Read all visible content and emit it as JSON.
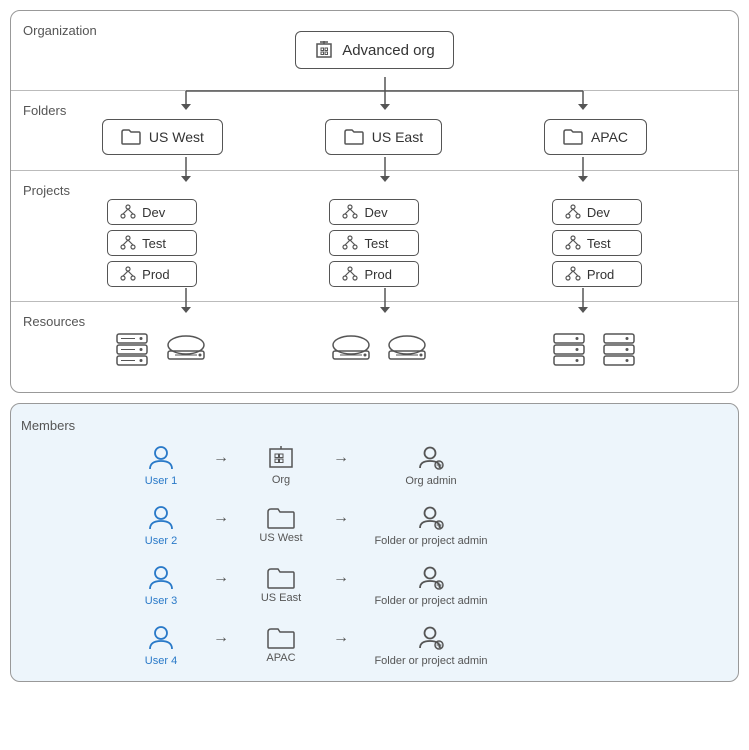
{
  "organization": {
    "label": "Organization",
    "org_name": "Advanced org"
  },
  "folders": {
    "label": "Folders",
    "items": [
      {
        "name": "US West"
      },
      {
        "name": "US East"
      },
      {
        "name": "APAC"
      }
    ]
  },
  "projects": {
    "label": "Projects",
    "columns": [
      {
        "items": [
          "Dev",
          "Test",
          "Prod"
        ]
      },
      {
        "items": [
          "Dev",
          "Test",
          "Prod"
        ]
      },
      {
        "items": [
          "Dev",
          "Test",
          "Prod"
        ]
      }
    ]
  },
  "resources": {
    "label": "Resources"
  },
  "members": {
    "label": "Members",
    "rows": [
      {
        "user": "User 1",
        "target": "Org",
        "role": "Org admin"
      },
      {
        "user": "User 2",
        "target": "US West",
        "role": "Folder or project admin"
      },
      {
        "user": "User 3",
        "target": "US East",
        "role": "Folder or project admin"
      },
      {
        "user": "User 4",
        "target": "APAC",
        "role": "Folder or project admin"
      }
    ]
  }
}
